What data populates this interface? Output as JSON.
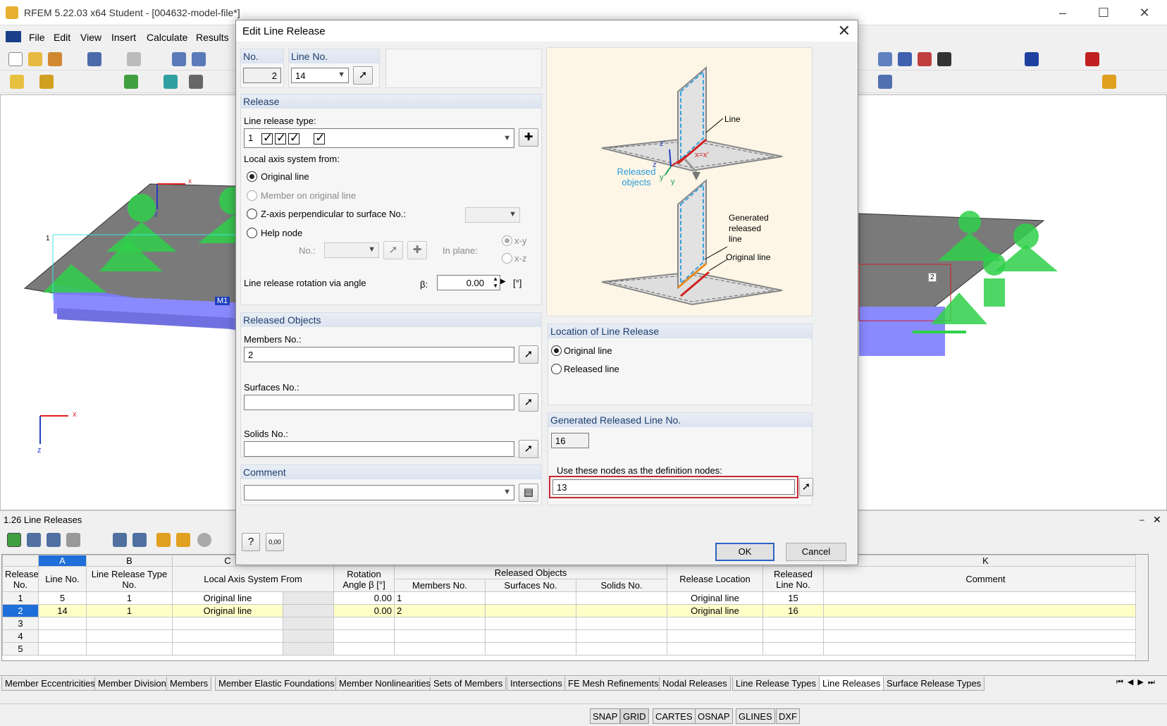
{
  "app": {
    "title": "RFEM 5.22.03 x64 Student - [004632-model-file*]",
    "menu": [
      "File",
      "Edit",
      "View",
      "Insert",
      "Calculate",
      "Results"
    ]
  },
  "viewport": {
    "labels": {
      "member": "M1",
      "node1": "1",
      "node2": "2"
    },
    "axes": {
      "x": "x",
      "z": "z"
    }
  },
  "panel": {
    "title": "1.26 Line Releases"
  },
  "table": {
    "letters": [
      "A",
      "B",
      "C",
      "",
      "",
      "",
      "",
      "",
      "",
      "",
      "K"
    ],
    "group_header": "Released Objects",
    "headers": {
      "release_no": "Release No.",
      "line_no": "Line No.",
      "type_no": "Line Release Type No.",
      "axis_from": "Local Axis System From",
      "rotation": "Rotation Angle β [°]",
      "members_no": "Members No.",
      "surfaces_no": "Surfaces No.",
      "solids_no": "Solids No.",
      "location": "Release Location",
      "released_line": "Released Line No.",
      "comment": "Comment"
    },
    "rows": [
      {
        "no": "1",
        "line": "5",
        "type": "1",
        "axis": "Original line",
        "angle": "0.00",
        "members": "1",
        "surfaces": "",
        "solids": "",
        "location": "Original line",
        "rline": "15",
        "comment": ""
      },
      {
        "no": "2",
        "line": "14",
        "type": "1",
        "axis": "Original line",
        "angle": "0.00",
        "members": "2",
        "surfaces": "",
        "solids": "",
        "location": "Original line",
        "rline": "16",
        "comment": ""
      },
      {
        "no": "3",
        "line": "",
        "type": "",
        "axis": "",
        "angle": "",
        "members": "",
        "surfaces": "",
        "solids": "",
        "location": "",
        "rline": "",
        "comment": ""
      },
      {
        "no": "4",
        "line": "",
        "type": "",
        "axis": "",
        "angle": "",
        "members": "",
        "surfaces": "",
        "solids": "",
        "location": "",
        "rline": "",
        "comment": ""
      },
      {
        "no": "5",
        "line": "",
        "type": "",
        "axis": "",
        "angle": "",
        "members": "",
        "surfaces": "",
        "solids": "",
        "location": "",
        "rline": "",
        "comment": ""
      }
    ]
  },
  "tabs": [
    "Member Eccentricities",
    "Member Divisions",
    "Members",
    "Member Elastic Foundations",
    "Member Nonlinearities",
    "Sets of Members",
    "Intersections",
    "FE Mesh Refinements",
    "Nodal Releases",
    "Line Release Types",
    "Line Releases",
    "Surface Release Types"
  ],
  "status": [
    "SNAP",
    "GRID",
    "CARTES",
    "OSNAP",
    "GLINES",
    "DXF"
  ],
  "dialog": {
    "title": "Edit Line Release",
    "no_label": "No.",
    "no_value": "2",
    "line_no_label": "Line No.",
    "line_no_value": "14",
    "release_header": "Release",
    "release_type_label": "Line release type:",
    "release_type_value": "1",
    "axis_from_label": "Local axis system from:",
    "opt_original": "Original line",
    "opt_member": "Member on original line",
    "opt_zaxis": "Z-axis perpendicular to surface No.:",
    "opt_help": "Help node",
    "help_no_label": "No.:",
    "in_plane_label": "In plane:",
    "plane_xy": "x-y",
    "plane_xz": "x-z",
    "rotation_label": "Line release rotation via angle",
    "beta_label": "β:",
    "beta_value": "0.00",
    "beta_unit": "[°]",
    "released_header": "Released Objects",
    "members_label": "Members No.:",
    "members_value": "2",
    "surfaces_label": "Surfaces No.:",
    "surfaces_value": "",
    "solids_label": "Solids No.:",
    "solids_value": "",
    "comment_header": "Comment",
    "comment_value": "",
    "location_header": "Location of Line Release",
    "loc_original": "Original line",
    "loc_released": "Released line",
    "generated_header": "Generated Released Line No.",
    "generated_value": "16",
    "def_nodes_label": "Use these nodes as the definition nodes:",
    "def_nodes_value": "13",
    "ok": "OK",
    "cancel": "Cancel",
    "illustration": {
      "line": "Line",
      "released_objects": "Released objects",
      "generated": "Generated released line",
      "original": "Original line",
      "xx": "x=x'",
      "z1": "z'",
      "z": "z",
      "y1": "y'",
      "y": "y"
    }
  }
}
